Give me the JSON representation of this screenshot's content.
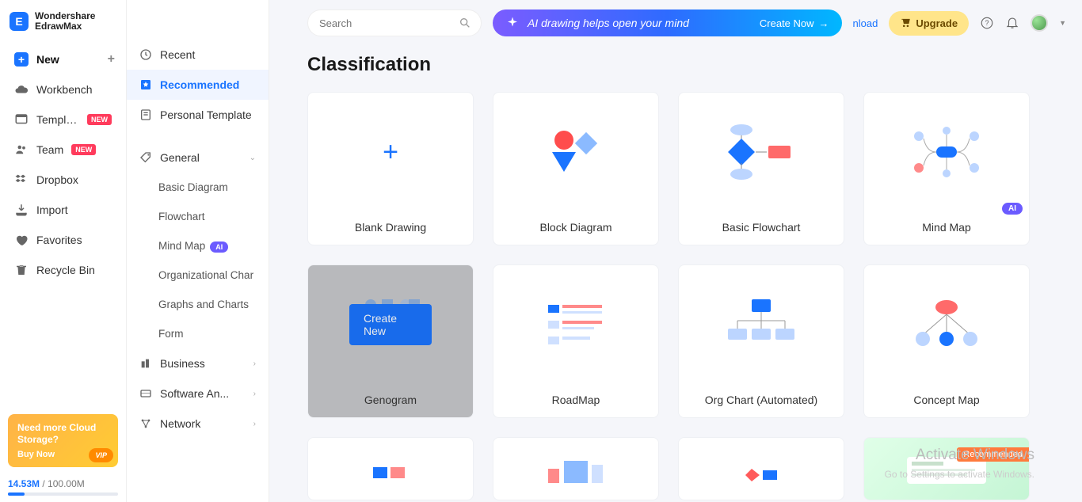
{
  "brand": {
    "line1": "Wondershare",
    "line2": "EdrawMax",
    "letter": "E"
  },
  "sidebar": {
    "items": [
      {
        "label": "New",
        "key": "new"
      },
      {
        "label": "Workbench",
        "key": "workbench"
      },
      {
        "label": "Templat...",
        "key": "templates",
        "badge": "NEW"
      },
      {
        "label": "Team",
        "key": "team",
        "badge": "NEW"
      },
      {
        "label": "Dropbox",
        "key": "dropbox"
      },
      {
        "label": "Import",
        "key": "import"
      },
      {
        "label": "Favorites",
        "key": "favorites"
      },
      {
        "label": "Recycle Bin",
        "key": "recycle"
      }
    ]
  },
  "cloud_promo": {
    "title": "Need more Cloud Storage?",
    "buy": "Buy Now",
    "vip": "VIP"
  },
  "storage": {
    "used": "14.53M",
    "total": "100.00M",
    "sep": " / "
  },
  "midpanel": {
    "top": [
      {
        "label": "Recent",
        "icon": "clock-icon"
      },
      {
        "label": "Recommended",
        "icon": "star-icon",
        "active": true
      },
      {
        "label": "Personal Template",
        "icon": "template-icon"
      }
    ],
    "general_label": "General",
    "general_items": [
      {
        "label": "Basic Diagram"
      },
      {
        "label": "Flowchart"
      },
      {
        "label": "Mind Map",
        "ai": "AI"
      },
      {
        "label": "Organizational Char"
      },
      {
        "label": "Graphs and Charts"
      },
      {
        "label": "Form"
      }
    ],
    "groups": [
      {
        "label": "Business"
      },
      {
        "label": "Software An..."
      },
      {
        "label": "Network"
      }
    ]
  },
  "topbar": {
    "search_placeholder": "Search",
    "ai_banner": "AI drawing helps open your mind",
    "create_now": "Create Now",
    "nload": "nload",
    "upgrade": "Upgrade"
  },
  "page_title": "Classification",
  "cards": [
    {
      "label": "Blank Drawing"
    },
    {
      "label": "Block Diagram"
    },
    {
      "label": "Basic Flowchart"
    },
    {
      "label": "Mind Map",
      "ai": "AI"
    },
    {
      "label": "Genogram",
      "hover": true,
      "create": "Create New"
    },
    {
      "label": "RoadMap"
    },
    {
      "label": "Org Chart (Automated)"
    },
    {
      "label": "Concept Map"
    }
  ],
  "recommended_badge": "Recommended",
  "watermark": {
    "title": "Activate Windows",
    "sub": "Go to Settings to activate Windows."
  }
}
